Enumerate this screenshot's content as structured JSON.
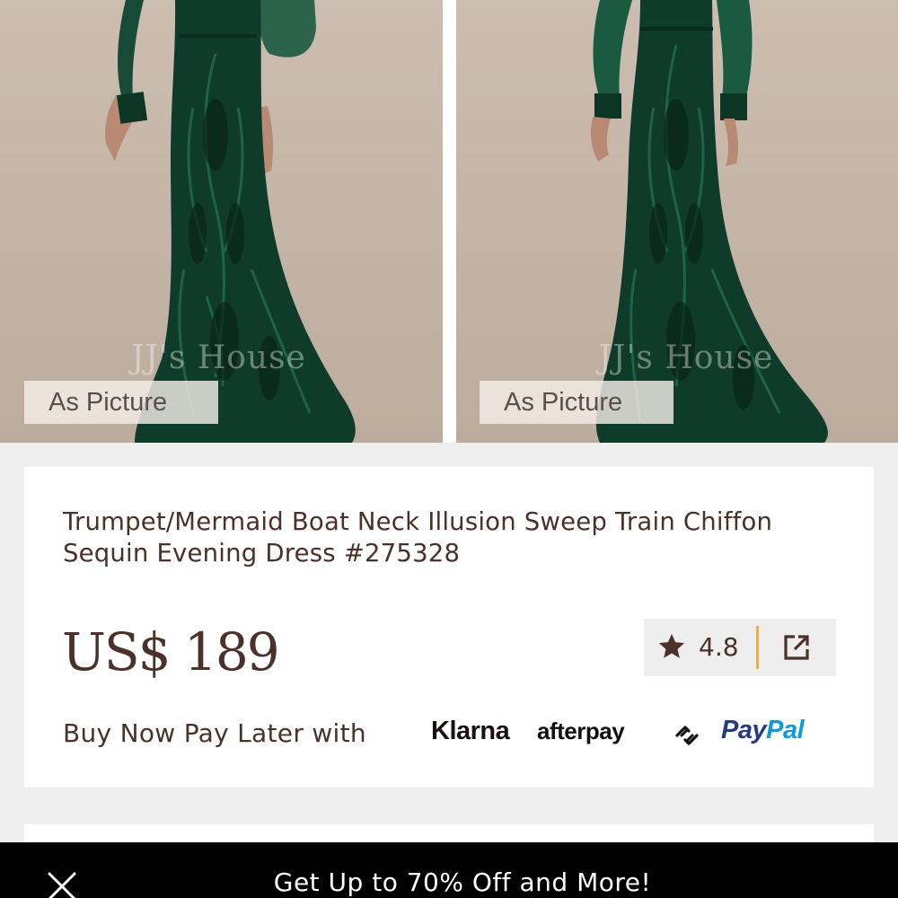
{
  "gallery": {
    "images": [
      {
        "alt": "Green sequin evening dress front view",
        "watermark": "JJ's House",
        "tag": "As Picture"
      },
      {
        "alt": "Green sequin evening dress front view alternate",
        "watermark": "JJ's House",
        "tag": "As Picture"
      }
    ],
    "dress_color": "#0f3b2b"
  },
  "product": {
    "title": "Trumpet/Mermaid Boat Neck Illusion Sweep Train Chiffon Sequin Evening Dress",
    "sku": "#275328",
    "price": "US$ 189",
    "rating": "4.8",
    "text_color": "#4a3129"
  },
  "payment": {
    "label": "Buy Now Pay Later with",
    "providers": {
      "klarna": "Klarna",
      "afterpay": "afterpay",
      "paypal_pay": "Pay",
      "paypal_pal": "Pal"
    }
  },
  "promo": {
    "text": "Get Up to 70% Off and More!",
    "close_icon": "close-icon"
  }
}
